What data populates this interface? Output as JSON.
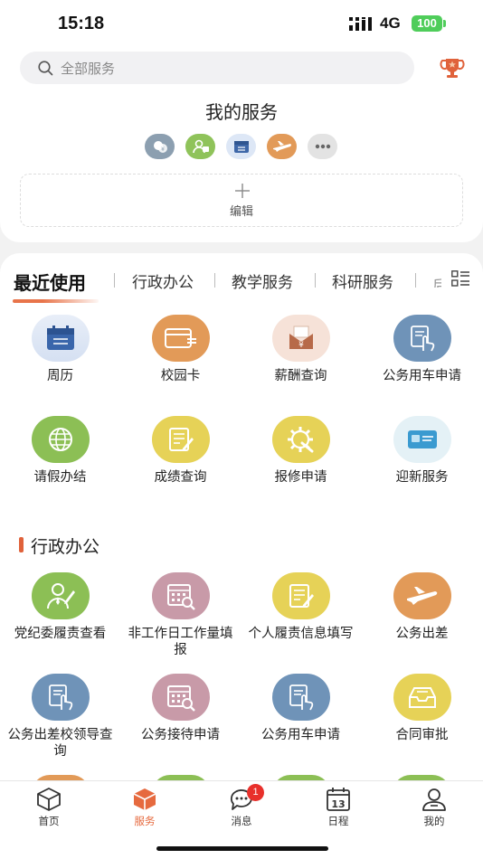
{
  "status": {
    "time": "15:18",
    "network": "4G",
    "battery": "100"
  },
  "search": {
    "placeholder": "全部服务"
  },
  "my_services": {
    "title": "我的服务",
    "edit_label": "编辑"
  },
  "tabs": [
    {
      "label": "最近使用"
    },
    {
      "label": "行政办公"
    },
    {
      "label": "教学服务"
    },
    {
      "label": "科研服务"
    }
  ],
  "recent": [
    {
      "label": "周历"
    },
    {
      "label": "校园卡"
    },
    {
      "label": "薪酬查询"
    },
    {
      "label": "公务用车申请"
    },
    {
      "label": "请假办结"
    },
    {
      "label": "成绩查询"
    },
    {
      "label": "报修申请"
    },
    {
      "label": "迎新服务"
    }
  ],
  "section_admin": {
    "title": "行政办公",
    "items": [
      {
        "label": "党纪委履责查看"
      },
      {
        "label": "非工作日工作量填报"
      },
      {
        "label": "个人履责信息填写"
      },
      {
        "label": "公务出差"
      },
      {
        "label": "公务出差校领导查询"
      },
      {
        "label": "公务接待申请"
      },
      {
        "label": "公务用车申请"
      },
      {
        "label": "合同审批"
      }
    ]
  },
  "tabbar": {
    "items": [
      {
        "label": "首页"
      },
      {
        "label": "服务"
      },
      {
        "label": "消息"
      },
      {
        "label": "日程"
      },
      {
        "label": "我的"
      }
    ],
    "message_badge": "1",
    "active_color": "#e66a3f"
  },
  "colors": {
    "accent": "#e66a3f",
    "tile_blue": "#6f93b8",
    "tile_green": "#8cbf55",
    "tile_orange": "#e29a58",
    "tile_yellow": "#e6d257",
    "tile_pink": "#c89aa8"
  }
}
